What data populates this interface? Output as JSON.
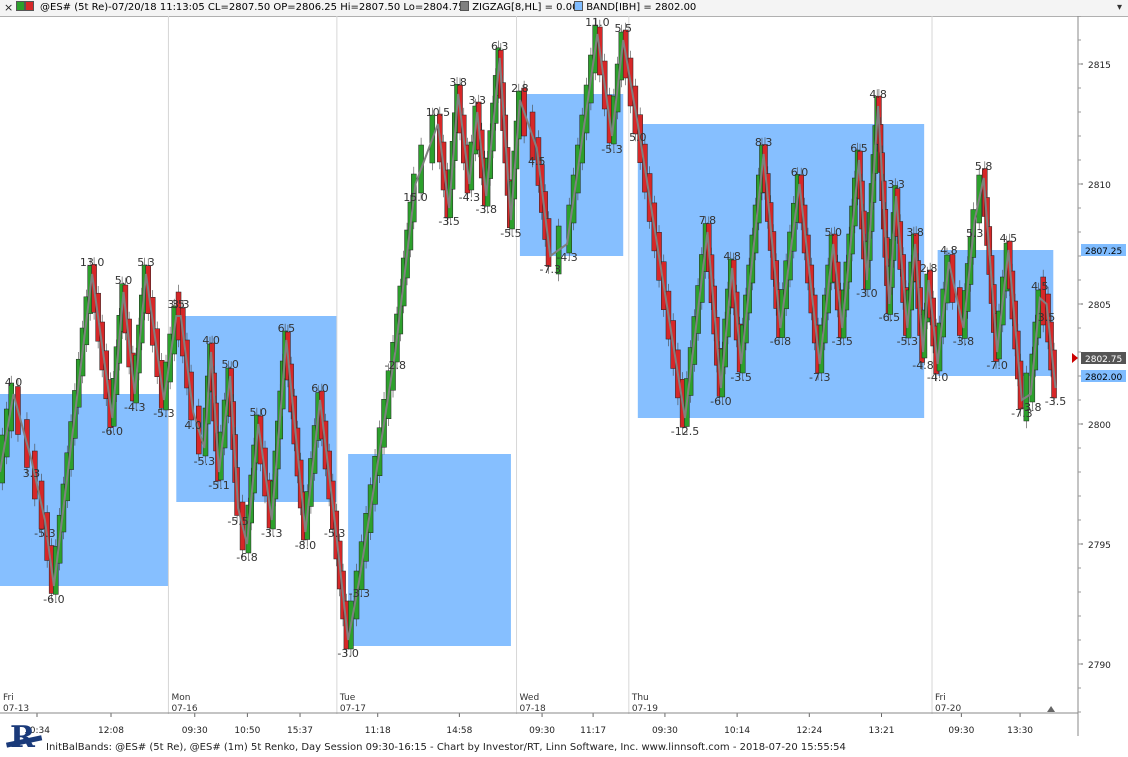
{
  "titlebar": {
    "close_glyph": "×",
    "symbol_info": "@ES# (5t Re)-07/20/18 11:13:05 CL=2807.50 OP=2806.25 Hi=2807.50 Lo=2804.75",
    "zigzag_label": "ZIGZAG[8,HL] = 0.00",
    "band_label": "BAND[IBH] = 2802.00",
    "colors": {
      "up": "#2ca02c",
      "down": "#d62728",
      "zigzag": "#808080",
      "band": "#7fbcff"
    }
  },
  "footer": {
    "text": "InitBalBands: @ES# (5t Re), @ES# (1m) 5t Renko, Day Session 09:30-16:15 - Chart by Investor/RT, Linn Software, Inc. www.linnsoft.com - 2018-07-20 15:55:54"
  },
  "logo": {
    "letter": "R"
  },
  "chart_data": {
    "type": "candlestick",
    "title": "",
    "xlabel": "",
    "ylabel": "",
    "ylim": [
      2788,
      2817
    ],
    "y_ticks": [
      2790,
      2795,
      2800,
      2805,
      2810,
      2815
    ],
    "grid": "vertical session separators only",
    "price_markers": [
      {
        "label": "2807.25",
        "value": 2807.25,
        "color": "#7fbcff"
      },
      {
        "label": "2802.75",
        "value": 2802.75,
        "color": "#555555"
      },
      {
        "label": "2802.00",
        "value": 2802.0,
        "color": "#7fbcff"
      }
    ],
    "sessions": [
      {
        "day": "Fri",
        "date": "07-13",
        "start": 0,
        "end": 1.45,
        "times": [
          "10:34",
          "12:08"
        ]
      },
      {
        "day": "Mon",
        "date": "07-16",
        "start": 1.5,
        "end": 3.0,
        "times": [
          "09:30",
          "10:50",
          "15:37"
        ]
      },
      {
        "day": "Tue",
        "date": "07-17",
        "start": 3.0,
        "end": 4.6,
        "times": [
          "11:18",
          "14:58"
        ]
      },
      {
        "day": "Wed",
        "date": "07-18",
        "start": 4.6,
        "end": 5.6,
        "times": [
          "09:30",
          "11:17"
        ]
      },
      {
        "day": "Thu",
        "date": "07-19",
        "start": 5.6,
        "end": 8.3,
        "times": [
          "09:30",
          "10:14",
          "12:24",
          "13:21"
        ]
      },
      {
        "day": "Fri",
        "date": "07-20",
        "start": 8.3,
        "end": 9.45,
        "times": [
          "09:30",
          "13:30"
        ]
      }
    ],
    "bands": [
      {
        "x0": 0.0,
        "x1": 1.5,
        "low": 2793.25,
        "high": 2801.25
      },
      {
        "x0": 1.57,
        "x1": 3.0,
        "low": 2796.75,
        "high": 2804.5
      },
      {
        "x0": 3.1,
        "x1": 4.55,
        "low": 2790.75,
        "high": 2798.75
      },
      {
        "x0": 4.63,
        "x1": 5.55,
        "low": 2807.0,
        "high": 2813.75
      },
      {
        "x0": 5.68,
        "x1": 8.23,
        "low": 2800.25,
        "high": 2812.5
      },
      {
        "x0": 8.35,
        "x1": 9.38,
        "low": 2802.0,
        "high": 2807.25
      }
    ],
    "zigzag_pivots": [
      {
        "x": 0.0,
        "y": 2798.0
      },
      {
        "x": 0.12,
        "y": 2801.25,
        "label": "4.0"
      },
      {
        "x": 0.28,
        "y": 2798.5,
        "label": "3.3"
      },
      {
        "x": 0.4,
        "y": 2796.0,
        "label": "-5.3"
      },
      {
        "x": 0.48,
        "y": 2793.25,
        "label": "-6.0"
      },
      {
        "x": 0.82,
        "y": 2806.25,
        "label": "13.0"
      },
      {
        "x": 1.0,
        "y": 2800.25,
        "label": "-6.0"
      },
      {
        "x": 1.1,
        "y": 2805.5,
        "label": "5.0"
      },
      {
        "x": 1.2,
        "y": 2801.25,
        "label": "-4.3"
      },
      {
        "x": 1.3,
        "y": 2806.25,
        "label": "5.3"
      },
      {
        "x": 1.46,
        "y": 2801.0,
        "label": "-5.3"
      },
      {
        "x": 1.57,
        "y": 2804.5,
        "label": "3.5"
      },
      {
        "x": 1.61,
        "y": 2804.5,
        "label": "3.3"
      },
      {
        "x": 1.72,
        "y": 2800.5,
        "label": "4.0"
      },
      {
        "x": 1.82,
        "y": 2799.0,
        "label": "-5.3"
      },
      {
        "x": 1.88,
        "y": 2803.0,
        "label": "4.0"
      },
      {
        "x": 1.95,
        "y": 2798.0,
        "label": "-5.1"
      },
      {
        "x": 2.05,
        "y": 2802.0,
        "label": "5.0"
      },
      {
        "x": 2.12,
        "y": 2796.5,
        "label": "-5.5"
      },
      {
        "x": 2.2,
        "y": 2795.0,
        "label": "-6.8"
      },
      {
        "x": 2.3,
        "y": 2800.0,
        "label": "5.0"
      },
      {
        "x": 2.42,
        "y": 2796.0,
        "label": "-3.3"
      },
      {
        "x": 2.55,
        "y": 2803.5,
        "label": "6.5"
      },
      {
        "x": 2.72,
        "y": 2795.5,
        "label": "-8.0"
      },
      {
        "x": 2.85,
        "y": 2801.0,
        "label": "6.0"
      },
      {
        "x": 2.98,
        "y": 2796.0,
        "label": "-5.3"
      },
      {
        "x": 3.1,
        "y": 2791.0,
        "label": "-3.0"
      },
      {
        "x": 3.2,
        "y": 2793.5,
        "label": "-3.3"
      },
      {
        "x": 3.52,
        "y": 2803.0,
        "label": "-2.8"
      },
      {
        "x": 3.7,
        "y": 2810.0,
        "label": "15.0"
      },
      {
        "x": 3.9,
        "y": 2812.5,
        "label": "10.5"
      },
      {
        "x": 4.0,
        "y": 2809.0,
        "label": "-3.5"
      },
      {
        "x": 4.08,
        "y": 2813.75,
        "label": "3.8"
      },
      {
        "x": 4.18,
        "y": 2810.0,
        "label": "-4.3"
      },
      {
        "x": 4.25,
        "y": 2813.0,
        "label": "3.3"
      },
      {
        "x": 4.33,
        "y": 2809.5,
        "label": "-3.8"
      },
      {
        "x": 4.45,
        "y": 2815.25,
        "label": "6.3"
      },
      {
        "x": 4.55,
        "y": 2808.5,
        "label": "-5.5"
      },
      {
        "x": 4.63,
        "y": 2813.5,
        "label": "2.8"
      },
      {
        "x": 4.78,
        "y": 2811.5,
        "label": "4.5"
      },
      {
        "x": 4.9,
        "y": 2807.0,
        "label": "-7.3"
      },
      {
        "x": 5.05,
        "y": 2807.5,
        "label": "-4.3"
      },
      {
        "x": 5.32,
        "y": 2816.25,
        "label": "11.0"
      },
      {
        "x": 5.45,
        "y": 2812.0,
        "label": "-5.3"
      },
      {
        "x": 5.55,
        "y": 2816.0,
        "label": "5.5"
      },
      {
        "x": 5.68,
        "y": 2812.5,
        "label": "5.0"
      },
      {
        "x": 6.1,
        "y": 2800.25,
        "label": "-12.5"
      },
      {
        "x": 6.3,
        "y": 2808.0,
        "label": "7.8"
      },
      {
        "x": 6.42,
        "y": 2801.5,
        "label": "-6.0"
      },
      {
        "x": 6.52,
        "y": 2806.5,
        "label": "4.8"
      },
      {
        "x": 6.6,
        "y": 2802.5,
        "label": "-3.5"
      },
      {
        "x": 6.8,
        "y": 2811.25,
        "label": "8.3"
      },
      {
        "x": 6.95,
        "y": 2804.0,
        "label": "-6.8"
      },
      {
        "x": 7.12,
        "y": 2810.0,
        "label": "6.0"
      },
      {
        "x": 7.3,
        "y": 2802.5,
        "label": "-7.3"
      },
      {
        "x": 7.42,
        "y": 2807.5,
        "label": "5.0"
      },
      {
        "x": 7.5,
        "y": 2804.0,
        "label": "-3.5"
      },
      {
        "x": 7.65,
        "y": 2811.0,
        "label": "6.5"
      },
      {
        "x": 7.72,
        "y": 2806.0,
        "label": "-3.0"
      },
      {
        "x": 7.82,
        "y": 2813.25,
        "label": "4.8"
      },
      {
        "x": 7.92,
        "y": 2805.0,
        "label": "-6.5"
      },
      {
        "x": 7.98,
        "y": 2809.5,
        "label": "3.3"
      },
      {
        "x": 8.08,
        "y": 2804.0,
        "label": "-5.3"
      },
      {
        "x": 8.15,
        "y": 2807.5,
        "label": "3.8"
      },
      {
        "x": 8.22,
        "y": 2803.0,
        "label": "-4.8"
      },
      {
        "x": 8.27,
        "y": 2806.0,
        "label": "2.8"
      },
      {
        "x": 8.35,
        "y": 2802.5,
        "label": "-4.0"
      },
      {
        "x": 8.45,
        "y": 2806.75,
        "label": "4.8"
      },
      {
        "x": 8.58,
        "y": 2804.0,
        "label": "-3.8"
      },
      {
        "x": 8.68,
        "y": 2808.5,
        "label": "5.3"
      },
      {
        "x": 8.76,
        "y": 2810.25,
        "label": "5.8"
      },
      {
        "x": 8.88,
        "y": 2803.0,
        "label": "-7.0"
      },
      {
        "x": 8.98,
        "y": 2807.25,
        "label": "4.5"
      },
      {
        "x": 9.1,
        "y": 2801.0,
        "label": "-7.3"
      },
      {
        "x": 9.18,
        "y": 2801.25,
        "label": "-3.8"
      },
      {
        "x": 9.26,
        "y": 2805.25,
        "label": "4.5"
      },
      {
        "x": 9.32,
        "y": 2805.0,
        "label": "3.5"
      },
      {
        "x": 9.4,
        "y": 2801.5,
        "label": "-3.5"
      }
    ]
  }
}
